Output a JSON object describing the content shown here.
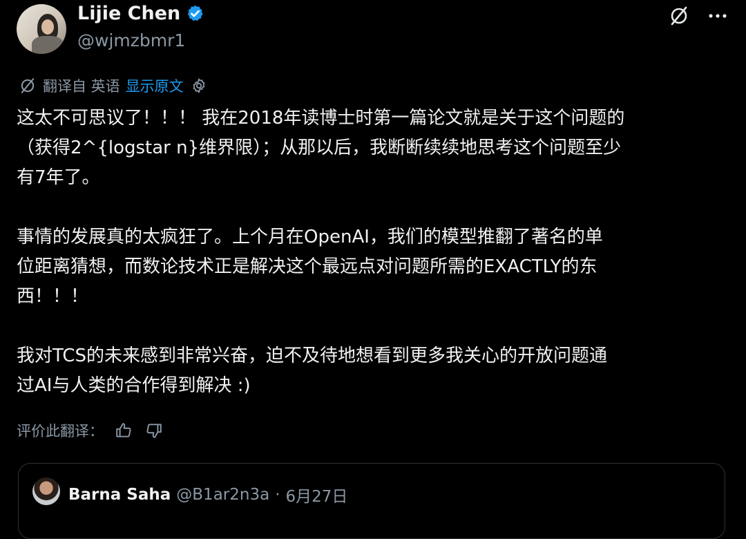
{
  "author": {
    "name": "Lijie Chen",
    "handle": "@wjmzbmr1",
    "verified_color": "#1d9bf0"
  },
  "top_icons": [
    "grok-icon",
    "more-icon"
  ],
  "translation": {
    "label": "翻译自 英语",
    "show_original": "显示原文",
    "accent": "#1d9bf0"
  },
  "body": {
    "p1": "这太不可思议了！！！ 我在2018年读博士时第一篇论文就是关于这个问题的\n（获得2^{logstar n}维界限）；从那以后，我断断续续地思考这个问题至少\n有7年了。",
    "p2": "事情的发展真的太疯狂了。上个月在OpenAI，我们的模型推翻了著名的单\n位距离猜想，而数论技术正是解决这个最远点对问题所需的EXACTLY的东\n西！！！",
    "p3": "我对TCS的未来感到非常兴奋，迫不及待地想看到更多我关心的开放问题通\n过AI与人类的合作得到解决 :)"
  },
  "rating": {
    "label": "评价此翻译："
  },
  "quoted": {
    "name": "Barna Saha",
    "handle": "@B1ar2n3a",
    "separator": "·",
    "date": "6月27日"
  }
}
